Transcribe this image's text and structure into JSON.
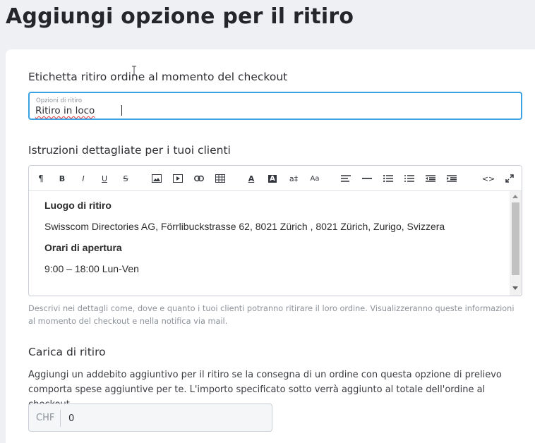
{
  "page": {
    "title": "Aggiungi opzione per il ritiro"
  },
  "pickup_label": {
    "section_label": "Etichetta ritiro ordine al momento del checkout",
    "field_label": "Opzioni di ritiro",
    "value": "Ritiro in loco"
  },
  "instructions": {
    "section_label": "Istruzioni dettagliate per i tuoi clienti",
    "toolbar": [
      {
        "icon": "paragraph-icon",
        "glyph": "¶"
      },
      {
        "icon": "bold-icon",
        "glyph": "B"
      },
      {
        "icon": "italic-icon",
        "glyph": "I"
      },
      {
        "icon": "underline-icon",
        "glyph": "U"
      },
      {
        "icon": "strikethrough-icon",
        "glyph": "S"
      },
      {
        "icon": "image-icon",
        "glyph": ""
      },
      {
        "icon": "video-icon",
        "glyph": ""
      },
      {
        "icon": "link-icon",
        "glyph": ""
      },
      {
        "icon": "table-icon",
        "glyph": ""
      },
      {
        "icon": "text-color-icon",
        "glyph": "A"
      },
      {
        "icon": "background-color-icon",
        "glyph": "A"
      },
      {
        "icon": "font-size-icon",
        "glyph": "a‡"
      },
      {
        "icon": "text-case-icon",
        "glyph": "Aa"
      },
      {
        "icon": "align-icon",
        "glyph": ""
      },
      {
        "icon": "horizontal-line-icon",
        "glyph": ""
      },
      {
        "icon": "bullet-list-icon",
        "glyph": ""
      },
      {
        "icon": "numbered-list-icon",
        "glyph": ""
      },
      {
        "icon": "outdent-icon",
        "glyph": ""
      },
      {
        "icon": "indent-icon",
        "glyph": ""
      },
      {
        "icon": "code-view-icon",
        "glyph": "<>"
      },
      {
        "icon": "fullscreen-icon",
        "glyph": ""
      }
    ],
    "content": {
      "heading_location": "Luogo di ritiro",
      "address": "Swisscom Directories AG, Förrlibuckstrasse 62, 8021 Zürich , 8021 Zürich, Zurigo, Svizzera",
      "heading_hours": "Orari di apertura",
      "hours": "9:00 – 18:00 Lun-Ven"
    },
    "hint": "Descrivi nei dettagli come, dove e quanto i tuoi clienti potranno ritirare il loro ordine. Visualizzeranno queste informazioni al momento del checkout e nella notifica via mail."
  },
  "charge": {
    "section_label": "Carica di ritiro",
    "description": "Aggiungi un addebito aggiuntivo per il ritiro se la consegna di un ordine con questa opzione di prelievo comporta spese aggiuntive per te. L'importo specificato sotto verrà aggiunto al totale dell'ordine al checkout.",
    "currency": "CHF",
    "value": "0"
  },
  "colors": {
    "background": "#eef0f4",
    "focus_border": "#3aa2e2",
    "hint_text": "#8d929a"
  }
}
